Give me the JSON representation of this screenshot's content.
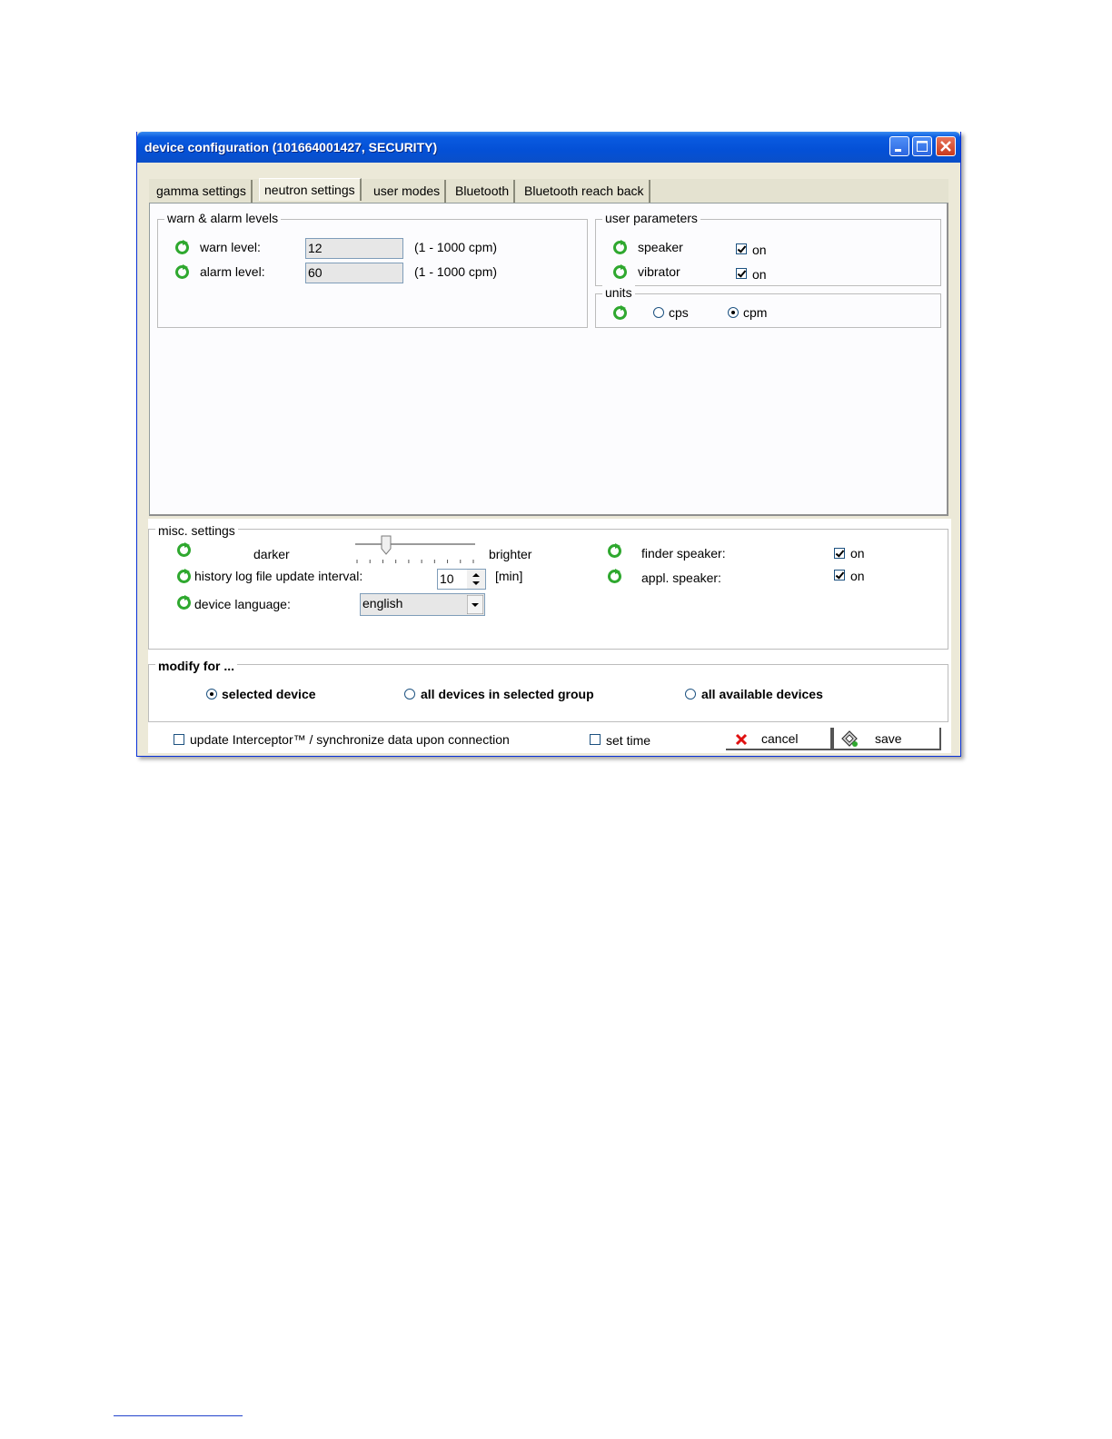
{
  "window": {
    "title": "device configuration  (101664001427, SECURITY)"
  },
  "tabs": [
    {
      "label": "gamma settings",
      "active": false
    },
    {
      "label": "neutron settings",
      "active": true
    },
    {
      "label": "user modes",
      "active": false
    },
    {
      "label": "Bluetooth",
      "active": false
    },
    {
      "label": "Bluetooth reach back",
      "active": false
    }
  ],
  "warn_alarm": {
    "title": "warn & alarm levels",
    "warn_label": "warn level:",
    "warn_value": "12",
    "warn_range": "(1 - 1000  cpm)",
    "alarm_label": "alarm level:",
    "alarm_value": "60",
    "alarm_range": "(1 - 1000  cpm)"
  },
  "user_parameters": {
    "title": "user parameters",
    "speaker_label": "speaker",
    "speaker_on": "on",
    "speaker_checked": true,
    "vibrator_label": "vibrator",
    "vibrator_on": "on",
    "vibrator_checked": true
  },
  "units": {
    "title": "units",
    "cps": "cps",
    "cpm": "cpm",
    "selected": "cpm"
  },
  "misc": {
    "title": "misc. settings",
    "darker": "darker",
    "brighter": "brighter",
    "brightness_level": 0.25,
    "history_label": "history log file update interval:",
    "history_value": "10",
    "history_unit": "[min]",
    "language_label": "device language:",
    "language_value": "english",
    "finder_speaker_label": "finder speaker:",
    "finder_speaker_on": "on",
    "appl_speaker_label": "appl. speaker:",
    "appl_speaker_on": "on"
  },
  "modify": {
    "title": "modify for ...",
    "selected_device": "selected device",
    "all_in_group": "all devices in selected group",
    "all_available": "all available devices"
  },
  "footer": {
    "update_label": "update Interceptor™ / synchronize data upon connection",
    "set_time_label": "set time",
    "cancel_label": "cancel",
    "save_label": "save"
  },
  "colors": {
    "title_blue": "#0450d6",
    "refresh_green": "#2fa82f",
    "cancel_red": "#e01010"
  }
}
